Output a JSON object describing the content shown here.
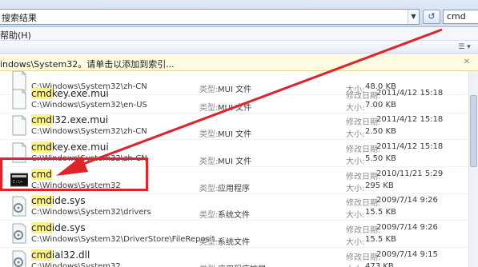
{
  "address_bar": {
    "text": "搜索结果",
    "dropdown_icon": "chevron-down-icon"
  },
  "nav_button": {
    "icon": "refresh-icon",
    "glyph": "↺"
  },
  "search": {
    "value": "cmd"
  },
  "menu": {
    "help": "帮助(H)"
  },
  "infobar": {
    "text": "indows\\System32。请单击以添加到索引..."
  },
  "files": [
    {
      "name": "",
      "name_rest": "",
      "path": "C:\\Windows\\System32\\zh-CN",
      "type_label": "类型:",
      "type": "MUI 文件",
      "date_label": "",
      "date": "",
      "size_label": "大小:",
      "size": "48.0 KB",
      "icon": "file-icon"
    },
    {
      "name": "cmd",
      "name_rest": "key.exe.mui",
      "path": "C:\\Windows\\System32\\en-US",
      "type_label": "类型:",
      "type": "MUI 文件",
      "date_label": "修改日期:",
      "date": "2011/4/12 15:18",
      "size_label": "大小:",
      "size": "7.00 KB",
      "icon": "file-icon"
    },
    {
      "name": "cmd",
      "name_rest": "l32.exe.mui",
      "path": "C:\\Windows\\System32\\zh-CN",
      "type_label": "类型:",
      "type": "MUI 文件",
      "date_label": "修改日期:",
      "date": "2011/4/12 15:18",
      "size_label": "大小:",
      "size": "2.50 KB",
      "icon": "file-icon"
    },
    {
      "name": "cmd",
      "name_rest": "key.exe.mui",
      "path": "C:\\Windows\\System32\\zh-CN",
      "type_label": "类型:",
      "type": "MUI 文件",
      "date_label": "修改日期:",
      "date": "2011/4/12 15:18",
      "size_label": "大小:",
      "size": "5.50 KB",
      "icon": "file-icon"
    },
    {
      "name": "cmd",
      "name_rest": "",
      "path": "C:\\Windows\\System32",
      "type_label": "类型:",
      "type": "应用程序",
      "date_label": "修改日期:",
      "date": "2010/11/21 5:29",
      "size_label": "大小:",
      "size": "295 KB",
      "icon": "console-icon"
    },
    {
      "name": "cmd",
      "name_rest": "ide.sys",
      "path": "C:\\Windows\\System32\\drivers",
      "type_label": "类型:",
      "type": "系统文件",
      "date_label": "修改日期:",
      "date": "2009/7/14 9:26",
      "size_label": "大小:",
      "size": "15.5 KB",
      "icon": "system-file-icon"
    },
    {
      "name": "cmd",
      "name_rest": "ide.sys",
      "path": "C:\\Windows\\System32\\DriverStore\\FileReposit...",
      "type_label": "类型:",
      "type": "系统文件",
      "date_label": "修改日期:",
      "date": "2009/7/14 9:26",
      "size_label": "大小:",
      "size": "15.5 KB",
      "icon": "system-file-icon"
    },
    {
      "name": "cmd",
      "name_rest": "ial32.dll",
      "path": "C:\\Windows\\System32",
      "type_label": "类型:",
      "type": "应用程序扩展",
      "date_label": "修改日期:",
      "date": "2009/7/14 9:15",
      "size_label": "大小:",
      "size": "473 KB",
      "icon": "dll-icon"
    }
  ],
  "colors": {
    "highlight_box": "#e0232b",
    "arrow": "#e0232b",
    "name_highlight": "#fbf28a",
    "infobar": "#fffbe3"
  }
}
